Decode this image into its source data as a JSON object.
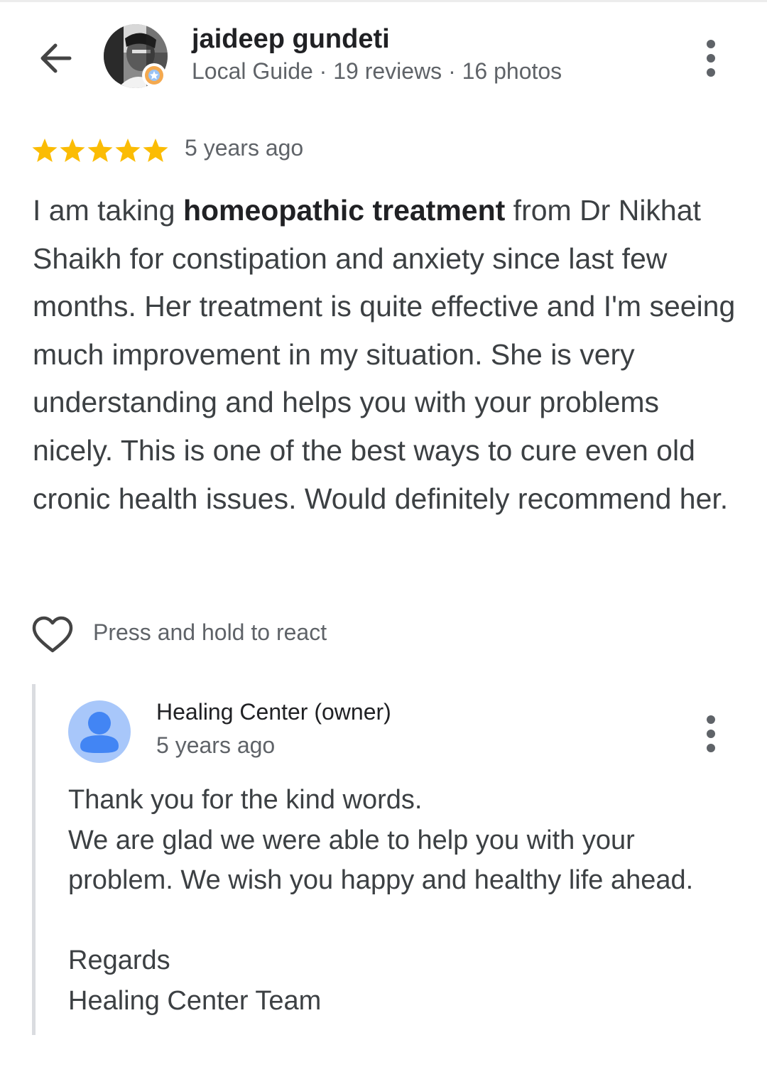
{
  "header": {
    "back_icon": "arrow-back-icon",
    "reviewer_name": "jaideep gundeti",
    "reviewer_meta": "Local Guide · 19 reviews · 16 photos",
    "menu_icon": "more-vert-icon"
  },
  "review": {
    "rating": 5,
    "rating_max": 5,
    "star_color": "#fbbc04",
    "time": "5 years ago",
    "text_before": "I am taking ",
    "text_bold": "homeopathic treatment",
    "text_after": " from Dr Nikhat Shaikh for constipation and anxiety since last few months. Her treatment is quite effective and I'm seeing much improvement in my situation. She is very understanding and helps you with your problems nicely. This is one of the best ways to cure even old cronic health issues. Would definitely recommend her."
  },
  "reaction": {
    "icon": "heart-outline-icon",
    "label": "Press and hold to react"
  },
  "owner_reply": {
    "name": "Healing Center (owner)",
    "time": "5 years ago",
    "avatar_icon": "person-avatar-icon",
    "avatar_bg": "#a8c7fa",
    "avatar_fg": "#4285f4",
    "menu_icon": "more-vert-icon",
    "lines": [
      "Thank you for the kind words.",
      "We are glad we were able to help you with your problem. We wish you happy and healthy life ahead.",
      "",
      "Regards",
      "Healing Center Team"
    ]
  }
}
